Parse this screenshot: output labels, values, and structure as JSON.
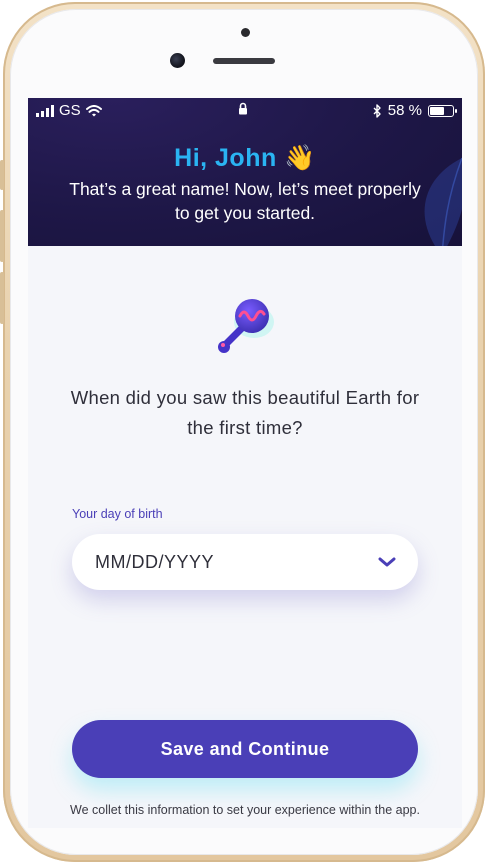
{
  "status_bar": {
    "carrier": "GS",
    "battery_percent": "58 %",
    "battery_level": 0.58,
    "icons": [
      "signal-icon",
      "wifi-icon",
      "lock-icon",
      "bluetooth-icon",
      "battery-icon"
    ]
  },
  "header": {
    "greeting": "Hi, John",
    "greeting_emoji": "👋",
    "subtitle": "That’s a great name! Now, let’s meet properly to get you started."
  },
  "illustration": {
    "icon": "rattle-icon"
  },
  "question": "When did you saw this beautiful Earth for the first time?",
  "dob": {
    "label": "Your day of birth",
    "placeholder": "MM/DD/YYYY",
    "icon": "chevron-down-icon"
  },
  "actions": {
    "save_label": "Save and Continue"
  },
  "footnote": "We collet this information to set your experience within the app.",
  "colors": {
    "header_bg": "#1e1747",
    "greeting": "#2ab4f2",
    "accent": "#4a3fb7",
    "screen_bg": "#f5f6fa"
  }
}
